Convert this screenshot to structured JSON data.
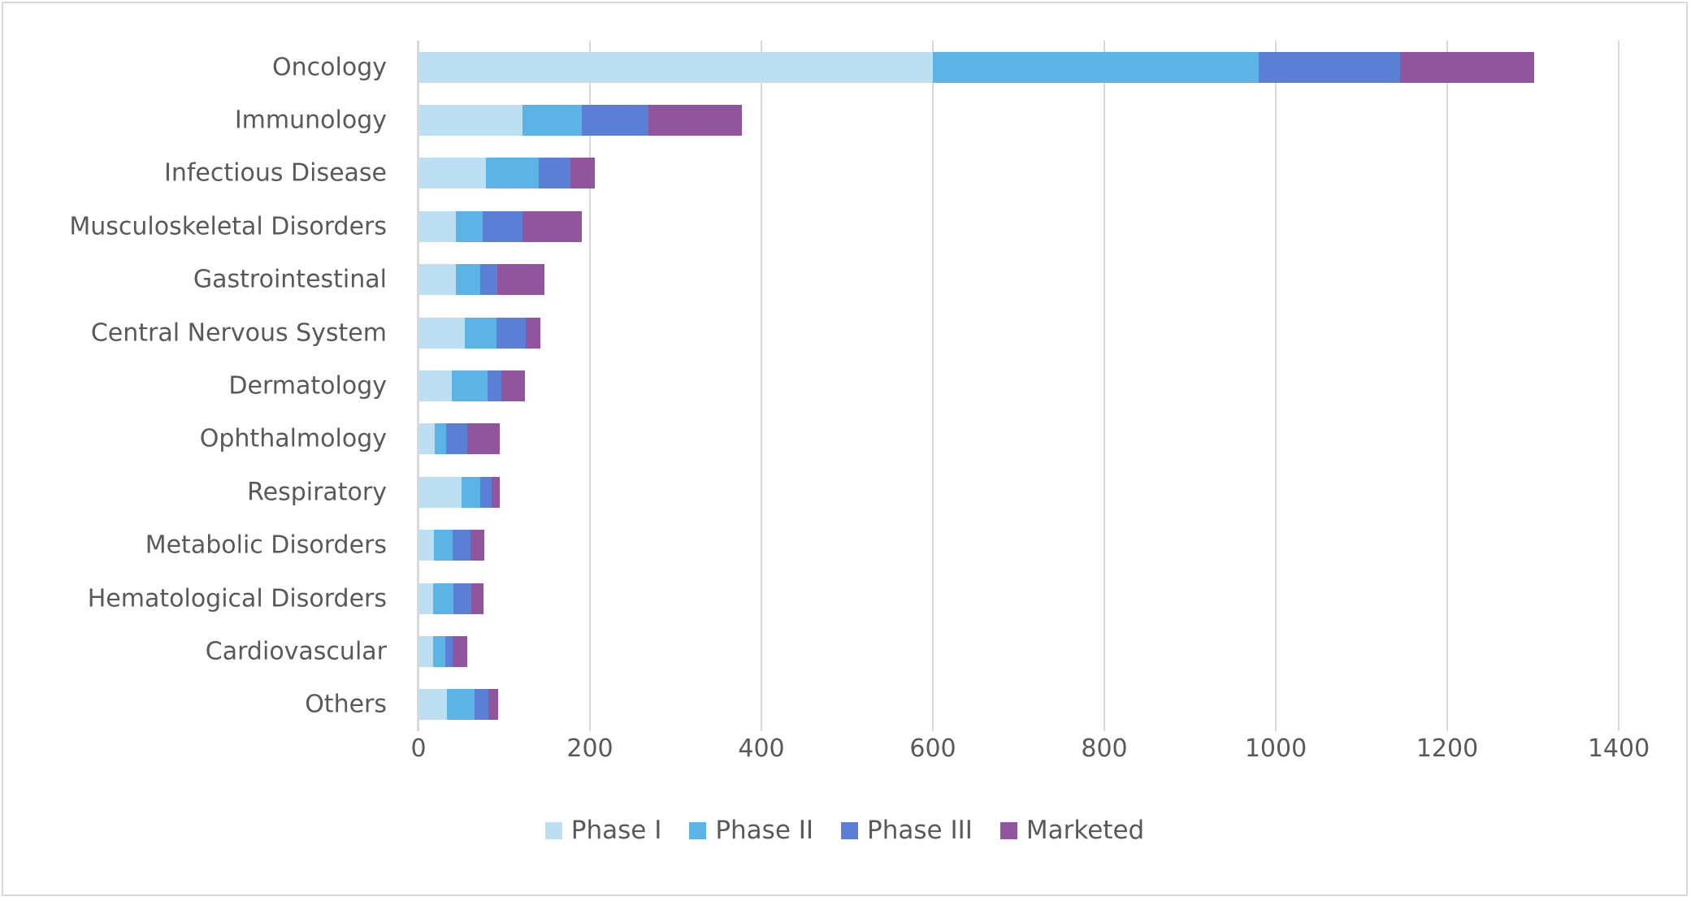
{
  "chart_data": {
    "type": "bar",
    "orientation": "horizontal",
    "stacked": true,
    "title": "",
    "xlabel": "",
    "ylabel": "",
    "xlim": [
      0,
      1400
    ],
    "xticks": [
      0,
      200,
      400,
      600,
      800,
      1000,
      1200,
      1400
    ],
    "xtick_labels": [
      "0",
      "200",
      "400",
      "600",
      "800",
      "1000",
      "1200",
      "1400"
    ],
    "grid": true,
    "legend_position": "bottom",
    "categories": [
      "Oncology",
      "Immunology",
      "Infectious Disease",
      "Musculoskeletal Disorders",
      "Gastrointestinal",
      "Central Nervous System",
      "Dermatology",
      "Ophthalmology",
      "Respiratory",
      "Metabolic Disorders",
      "Hematological Disorders",
      "Cardiovascular",
      "Others"
    ],
    "series": [
      {
        "name": "Phase I",
        "color": "#bce0f2",
        "values": [
          600,
          121,
          79,
          44,
          44,
          54,
          39,
          19,
          50,
          18,
          17,
          17,
          33
        ]
      },
      {
        "name": "Phase II",
        "color": "#5bb4e5",
        "values": [
          380,
          70,
          61,
          31,
          28,
          37,
          42,
          13,
          22,
          22,
          24,
          14,
          32
        ]
      },
      {
        "name": "Phase III",
        "color": "#5b7fd4",
        "values": [
          165,
          77,
          37,
          46,
          20,
          34,
          16,
          25,
          13,
          21,
          21,
          9,
          17
        ]
      },
      {
        "name": "Marketed",
        "color": "#91559e",
        "values": [
          156,
          109,
          29,
          70,
          55,
          17,
          27,
          38,
          10,
          16,
          14,
          17,
          11
        ]
      }
    ],
    "totals": [
      1301,
      377,
      206,
      191,
      147,
      142,
      124,
      95,
      95,
      77,
      76,
      57,
      93
    ]
  },
  "legend": {
    "items": [
      {
        "label": "Phase I",
        "color": "#bce0f2"
      },
      {
        "label": "Phase II",
        "color": "#5bb4e5"
      },
      {
        "label": "Phase III",
        "color": "#5b7fd4"
      },
      {
        "label": "Marketed",
        "color": "#91559e"
      }
    ]
  }
}
